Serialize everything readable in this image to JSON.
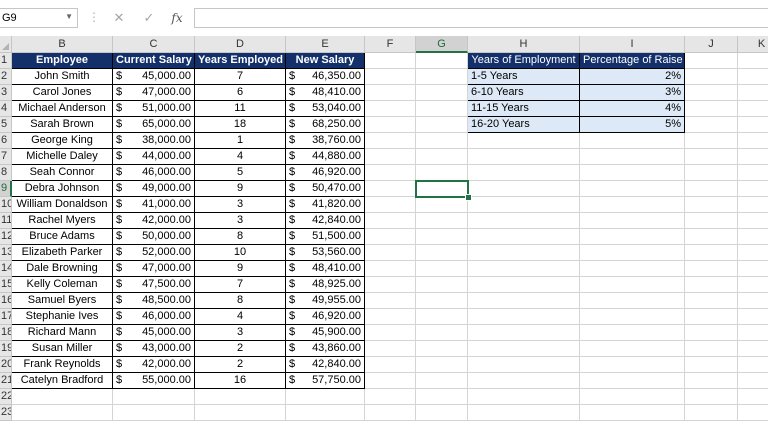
{
  "formula_bar": {
    "name_box": "G9",
    "cancel_icon": "✕",
    "enter_icon": "✓",
    "fx_label": "fx",
    "formula": ""
  },
  "columns": [
    "B",
    "C",
    "D",
    "E",
    "F",
    "G",
    "H",
    "I",
    "J",
    "K"
  ],
  "selected_column": "G",
  "selected_row": 9,
  "rows": [
    1,
    2,
    3,
    4,
    5,
    6,
    7,
    8,
    9,
    10,
    11,
    12,
    13,
    14,
    15,
    16,
    17,
    18,
    19,
    20,
    21,
    22,
    23
  ],
  "table": {
    "headers": [
      "Employee",
      "Current Salary",
      "Years Employed",
      "New Salary"
    ],
    "currency_symbol": "$",
    "records": [
      {
        "name": "John Smith",
        "current": "45,000.00",
        "years": "7",
        "new": "46,350.00"
      },
      {
        "name": "Carol Jones",
        "current": "47,000.00",
        "years": "6",
        "new": "48,410.00"
      },
      {
        "name": "Michael Anderson",
        "current": "51,000.00",
        "years": "11",
        "new": "53,040.00"
      },
      {
        "name": "Sarah Brown",
        "current": "65,000.00",
        "years": "18",
        "new": "68,250.00"
      },
      {
        "name": "George King",
        "current": "38,000.00",
        "years": "1",
        "new": "38,760.00"
      },
      {
        "name": "Michelle Daley",
        "current": "44,000.00",
        "years": "4",
        "new": "44,880.00"
      },
      {
        "name": "Seah Connor",
        "current": "46,000.00",
        "years": "5",
        "new": "46,920.00"
      },
      {
        "name": "Debra Johnson",
        "current": "49,000.00",
        "years": "9",
        "new": "50,470.00"
      },
      {
        "name": "William Donaldson",
        "current": "41,000.00",
        "years": "3",
        "new": "41,820.00"
      },
      {
        "name": "Rachel Myers",
        "current": "42,000.00",
        "years": "3",
        "new": "42,840.00"
      },
      {
        "name": "Bruce Adams",
        "current": "50,000.00",
        "years": "8",
        "new": "51,500.00"
      },
      {
        "name": "Elizabeth Parker",
        "current": "52,000.00",
        "years": "10",
        "new": "53,560.00"
      },
      {
        "name": "Dale Browning",
        "current": "47,000.00",
        "years": "9",
        "new": "48,410.00"
      },
      {
        "name": "Kelly Coleman",
        "current": "47,500.00",
        "years": "7",
        "new": "48,925.00"
      },
      {
        "name": "Samuel Byers",
        "current": "48,500.00",
        "years": "8",
        "new": "49,955.00"
      },
      {
        "name": "Stephanie Ives",
        "current": "46,000.00",
        "years": "4",
        "new": "46,920.00"
      },
      {
        "name": "Richard Mann",
        "current": "45,000.00",
        "years": "3",
        "new": "45,900.00"
      },
      {
        "name": "Susan Miller",
        "current": "43,000.00",
        "years": "2",
        "new": "43,860.00"
      },
      {
        "name": "Frank Reynolds",
        "current": "42,000.00",
        "years": "2",
        "new": "42,840.00"
      },
      {
        "name": "Catelyn Bradford",
        "current": "55,000.00",
        "years": "16",
        "new": "57,750.00"
      }
    ]
  },
  "lookup": {
    "headers": [
      "Years of Employment",
      "Percentage of Raise"
    ],
    "rows": [
      {
        "range": "1-5 Years",
        "pct": "2%"
      },
      {
        "range": "6-10 Years",
        "pct": "3%"
      },
      {
        "range": "11-15 Years",
        "pct": "4%"
      },
      {
        "range": "16-20 Years",
        "pct": "5%"
      }
    ]
  },
  "colors": {
    "header_fill": "#14306b",
    "lookup_fill": "#dde9f6",
    "selection": "#217346"
  }
}
